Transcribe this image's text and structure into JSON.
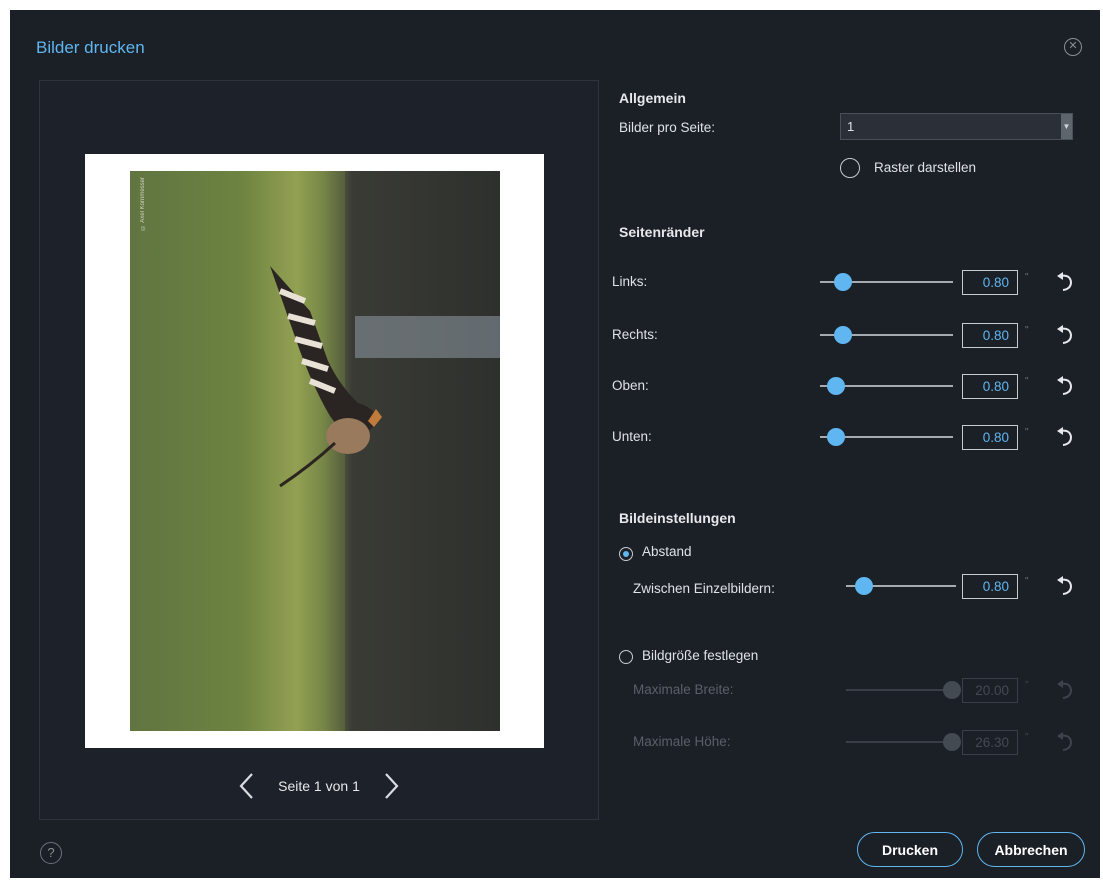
{
  "dialog": {
    "title": "Bilder drucken"
  },
  "preview": {
    "page_label": "Seite 1 von 1",
    "photo_credit": "© Axel Kornmesser",
    "icons": {
      "prev": "chevron-left-icon",
      "next": "chevron-right-icon"
    }
  },
  "general": {
    "title": "Allgemein",
    "images_per_page_label": "Bilder pro Seite:",
    "images_per_page_value": "1",
    "show_grid_label": "Raster darstellen"
  },
  "margins": {
    "title": "Seitenränder",
    "unit": "\"",
    "items": [
      {
        "label": "Links:",
        "value": "0.80",
        "level": 0.12
      },
      {
        "label": "Rechts:",
        "value": "0.80",
        "level": 0.12
      },
      {
        "label": "Oben:",
        "value": "0.80",
        "level": 0.06
      },
      {
        "label": "Unten:",
        "value": "0.80",
        "level": 0.06
      }
    ]
  },
  "image_settings": {
    "title": "Bildeinstellungen",
    "spacing_option": {
      "label": "Abstand",
      "selected": true
    },
    "between_label": "Zwischen Einzelbildern:",
    "between_value": "0.80",
    "between_level": 0.1,
    "size_option": {
      "label": "Bildgröße festlegen",
      "selected": false
    },
    "max_width_label": "Maximale Breite:",
    "max_width_value": "20.00",
    "max_height_label": "Maximale Höhe:",
    "max_height_value": "26.30"
  },
  "footer": {
    "print_label": "Drucken",
    "cancel_label": "Abbrechen",
    "help_glyph": "?"
  },
  "colors": {
    "accent": "#5fb6f0",
    "background": "#1b1f26"
  }
}
